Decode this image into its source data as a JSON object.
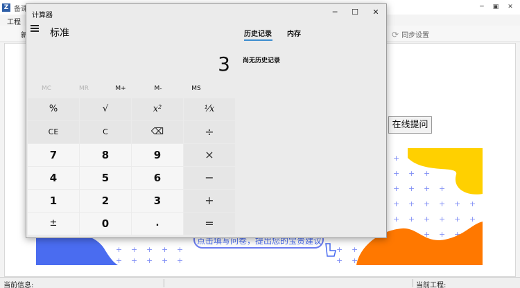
{
  "background_app": {
    "title": "备课",
    "logo_letter": "Z",
    "menu_project": "工程",
    "toolbar_partial": "新",
    "sync_label": "同步设置",
    "online_ask": "在线提问",
    "banner_text": "点击填写问卷，提出您的宝贵建议",
    "status_left": "当前信息:",
    "status_right": "当前工程:"
  },
  "calculator": {
    "window_title": "计算器",
    "mode": "标准",
    "display": "3",
    "tabs": {
      "history": "历史记录",
      "memory": "内存"
    },
    "history_empty": "尚无历史记录",
    "memory_buttons": [
      "MC",
      "MR",
      "M+",
      "M-",
      "MS"
    ],
    "keys": {
      "percent": "%",
      "sqrt": "√",
      "square": "x²",
      "reciprocal": "¹⁄x",
      "ce": "CE",
      "c": "C",
      "backspace": "⌫",
      "divide": "÷",
      "seven": "7",
      "eight": "8",
      "nine": "9",
      "multiply": "×",
      "four": "4",
      "five": "5",
      "six": "6",
      "minus": "−",
      "one": "1",
      "two": "2",
      "three": "3",
      "plus": "+",
      "negate": "±",
      "zero": "0",
      "decimal": ".",
      "equals": "="
    }
  },
  "colors": {
    "accent": "#3c8dcf",
    "banner_blue": "#4a6cf0",
    "banner_yellow": "#ffd000",
    "banner_orange": "#ff7800"
  }
}
